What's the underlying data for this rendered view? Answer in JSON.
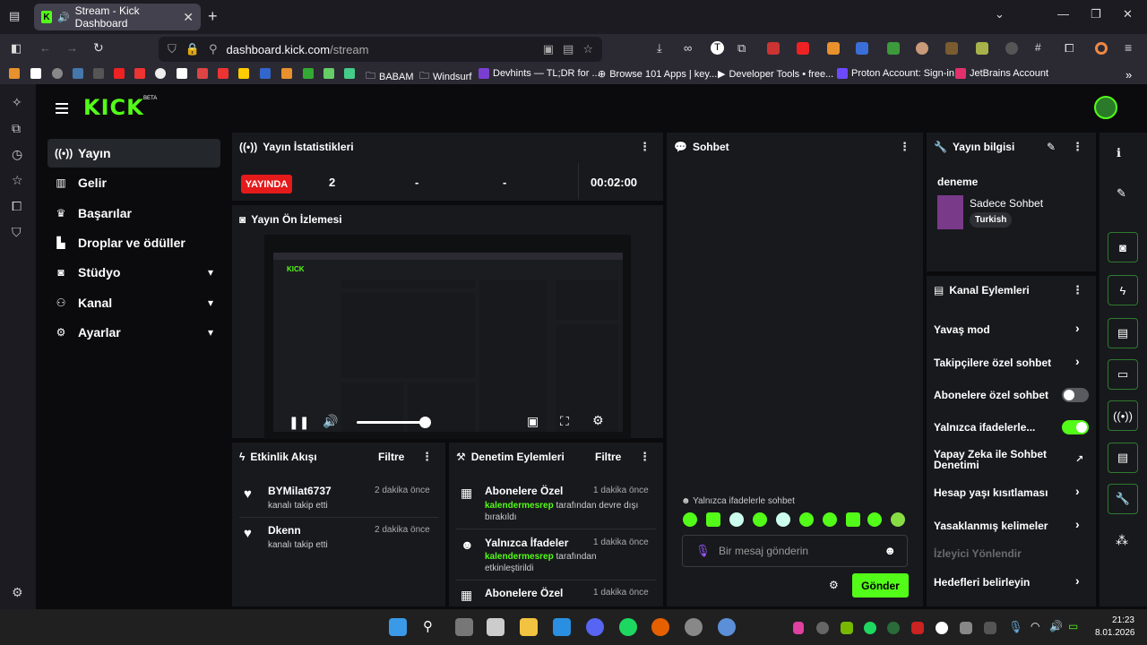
{
  "browser": {
    "tab_title": "Stream - Kick Dashboard",
    "url_domain": "dashboard.kick.com",
    "url_path": "/stream",
    "bookmarks": [
      "BABAM",
      "Windsurf",
      "Devhints — TL;DR for ...",
      "Browse 101 Apps | key...",
      "Developer Tools • free...",
      "Proton Account: Sign-in",
      "JetBrains Account"
    ]
  },
  "app": {
    "logo": "KICK",
    "logo_badge": "BETA"
  },
  "sidebar": {
    "items": [
      {
        "label": "Yayın",
        "icon": "broadcast-icon"
      },
      {
        "label": "Gelir",
        "icon": "chart-icon"
      },
      {
        "label": "Başarılar",
        "icon": "trophy-icon"
      },
      {
        "label": "Droplar ve ödüller",
        "icon": "gift-icon"
      },
      {
        "label": "Stüdyo",
        "icon": "camera-icon"
      },
      {
        "label": "Kanal",
        "icon": "users-icon"
      },
      {
        "label": "Ayarlar",
        "icon": "gear-icon"
      }
    ]
  },
  "stats": {
    "title": "Yayın İstatistikleri",
    "live_badge": "YAYINDA",
    "viewers": "2",
    "stat2": "-",
    "stat3": "-",
    "duration": "00:02:00"
  },
  "preview": {
    "title": "Yayın Ön İzlemesi",
    "volume_percent": 95
  },
  "activity": {
    "title": "Etkinlik Akışı",
    "filter": "Filtre",
    "items": [
      {
        "name": "BYMilat6737",
        "sub": "kanalı takip etti",
        "time": "2 dakika önce"
      },
      {
        "name": "Dkenn",
        "sub": "kanalı takip etti",
        "time": "2 dakika önce"
      }
    ]
  },
  "moderation": {
    "title": "Denetim Eylemleri",
    "filter": "Filtre",
    "items": [
      {
        "title": "Abonelere Özel",
        "user": "kalendermesrep",
        "text1": " tarafından devre dışı",
        "text2": "bırakıldı",
        "time": "1 dakika önce"
      },
      {
        "title": "Yalnızca İfadeler",
        "user": "kalendermesrep",
        "text1": " tarafından",
        "text2": "etkinleştirildi",
        "time": "1 dakika önce"
      },
      {
        "title": "Abonelere Özel",
        "time": "1 dakika önce"
      }
    ]
  },
  "chat": {
    "title": "Sohbet",
    "mode_notice": "Yalnızca ifadelerle sohbet",
    "placeholder": "Bir mesaj gönderin",
    "send": "Gönder"
  },
  "stream_info": {
    "title": "Yayın bilgisi",
    "stream_title": "deneme",
    "category": "Sadece Sohbet",
    "language": "Turkish"
  },
  "channel_actions": {
    "title": "Kanal Eylemleri",
    "items": [
      {
        "label": "Yavaş mod",
        "control": "arrow"
      },
      {
        "label": "Takipçilere özel sohbet",
        "control": "arrow"
      },
      {
        "label": "Abonelere özel sohbet",
        "control": "toggle-off"
      },
      {
        "label": "Yalnızca ifadelerle...",
        "control": "toggle-on"
      },
      {
        "label": "Yapay Zeka ile Sohbet Denetimi",
        "control": "external"
      },
      {
        "label": "Hesap yaşı kısıtlaması",
        "control": "arrow"
      },
      {
        "label": "Yasaklanmış kelimeler",
        "control": "arrow"
      },
      {
        "label": "İzleyici Yönlendir",
        "control": "disabled"
      },
      {
        "label": "Hedefleri belirleyin",
        "control": "arrow"
      }
    ]
  },
  "taskbar": {
    "time": "21:23",
    "date": "8.01.2026"
  },
  "colors": {
    "accent": "#53fc18",
    "live": "#e51a1a",
    "panel": "#18191d"
  }
}
